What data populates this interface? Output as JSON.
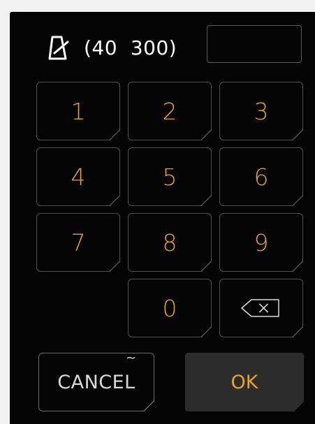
{
  "header": {
    "icon": "metronome-icon",
    "range_text": "(40  300)",
    "value": ""
  },
  "keypad": {
    "keys": [
      "1",
      "2",
      "3",
      "4",
      "5",
      "6",
      "7",
      "8",
      "9",
      "0"
    ],
    "backspace_icon": "backspace-icon"
  },
  "actions": {
    "cancel_label": "CANCEL",
    "cancel_hint": "~",
    "ok_label": "OK"
  },
  "colors": {
    "accent": "#e6a226",
    "background": "#040404",
    "key_border": "#505050",
    "ok_bg": "#2c2c2c"
  }
}
